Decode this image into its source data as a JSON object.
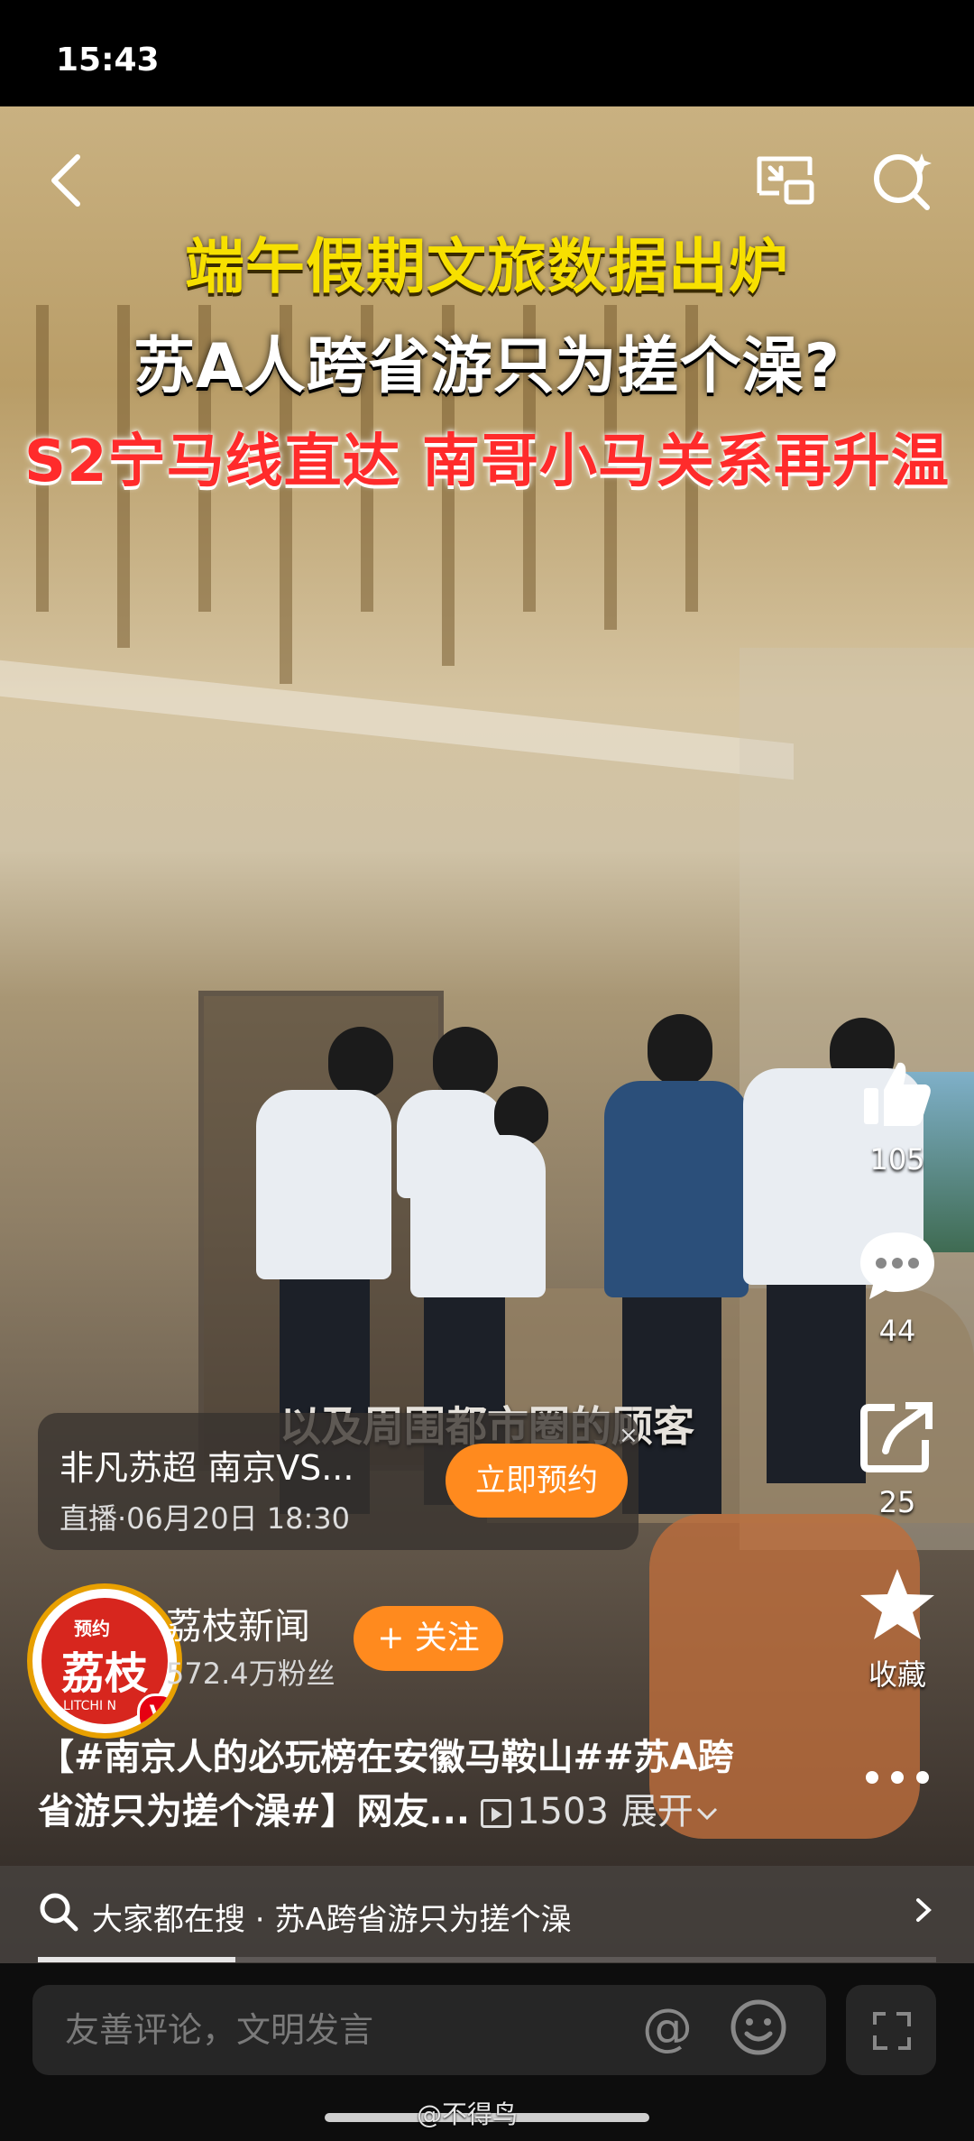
{
  "status_bar": {
    "time": "15:43"
  },
  "video": {
    "headline_1": "端午假期文旅数据出炉",
    "headline_2": "苏A人跨省游只为搓个澡?",
    "headline_3": "S2宁马线直达 南哥小马关系再升温",
    "subtitle": "以及周围都市圈的顾客"
  },
  "live_card": {
    "title": "非凡苏超 南京VS...",
    "time": "直播·06月20日 18:30",
    "reserve_label": "立即预约",
    "close_symbol": "×"
  },
  "actions": {
    "like_count": "105",
    "comment_count": "44",
    "share_count": "25",
    "favorite_label": "收藏"
  },
  "account": {
    "avatar_top": "预约",
    "avatar_main": "荔枝",
    "avatar_bottom": "LITCHI N",
    "verified_mark": "V",
    "name": "荔枝新闻",
    "fans": "572.4万粉丝",
    "follow_label": "+ 关注"
  },
  "description": {
    "line1": "【#南京人的必玩榜在安徽马鞍山##苏A跨",
    "line2": "省游只为搓个澡#】网友...",
    "views": "1503",
    "expand_label": "展开"
  },
  "search_strip": {
    "text": "大家都在搜 · 苏A跨省游只为搓个澡",
    "progress": 0.22
  },
  "comment_bar": {
    "placeholder": "友善评论，文明发言",
    "at_symbol": "@"
  },
  "watermark": "@不得鸟",
  "colors": {
    "accent_orange": "#ff8a1e",
    "headline_yellow": "#f7e000",
    "headline_red": "#ff2b2b"
  }
}
